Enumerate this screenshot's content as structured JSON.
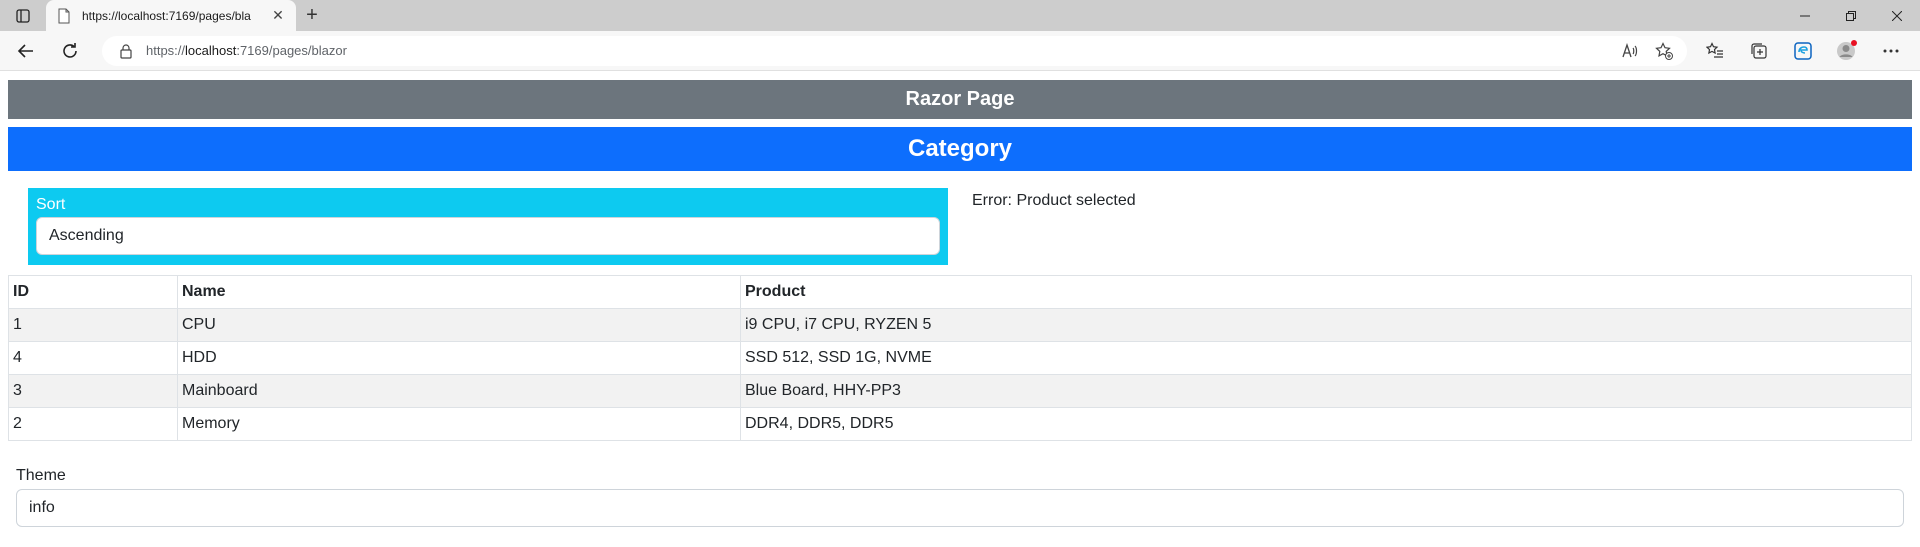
{
  "browser": {
    "tab_title": "https://localhost:7169/pages/bla",
    "url_prefix": "https://",
    "url_host": "localhost",
    "url_rest": ":7169/pages/blazor",
    "new_tab_glyph": "+",
    "tab_close_glyph": "✕"
  },
  "page": {
    "razor_title": "Razor Page",
    "category_title": "Category",
    "sort": {
      "label": "Sort",
      "value": "Ascending"
    },
    "error_text": "Error: Product selected",
    "table": {
      "headers": [
        "ID",
        "Name",
        "Product"
      ],
      "rows": [
        [
          "1",
          "CPU",
          "i9 CPU, i7 CPU, RYZEN 5"
        ],
        [
          "4",
          "HDD",
          "SSD 512, SSD 1G, NVME"
        ],
        [
          "3",
          "Mainboard",
          "Blue Board, HHY-PP3"
        ],
        [
          "2",
          "Memory",
          "DDR4, DDR5, DDR5"
        ]
      ]
    },
    "theme": {
      "label": "Theme",
      "value": "info"
    }
  },
  "colors": {
    "razor_header_bg": "#6c757d",
    "category_header_bg": "#0d6efd",
    "sort_box_bg": "#0dcaf0"
  }
}
